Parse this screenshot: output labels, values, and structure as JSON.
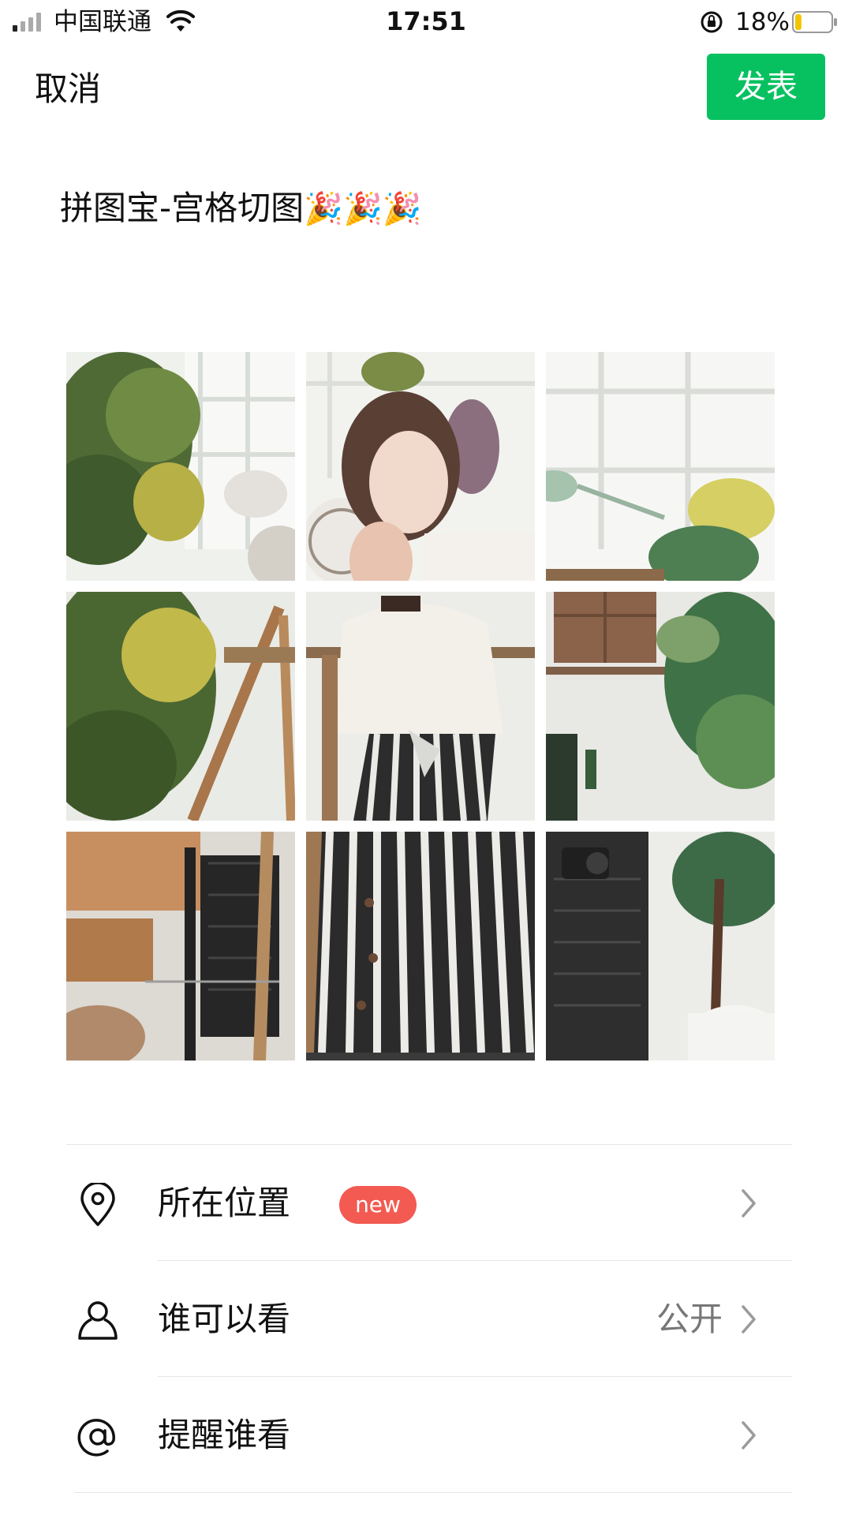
{
  "status_bar": {
    "carrier": "中国联通",
    "time": "17:51",
    "battery_percent": "18%",
    "battery_level": 0.18,
    "icons": [
      "signal-icon",
      "wifi-icon",
      "rotation-lock-icon",
      "battery-icon"
    ]
  },
  "nav": {
    "cancel_label": "取消",
    "publish_label": "发表",
    "publish_color": "#07c160"
  },
  "post": {
    "text": "拼图宝-宫格切图",
    "emoji": "🎉🎉🎉"
  },
  "photo_grid": {
    "rows": 3,
    "cols": 3
  },
  "options": [
    {
      "label": "所在位置",
      "badge": "new",
      "value": "",
      "icon": "location-pin-icon"
    },
    {
      "label": "谁可以看",
      "badge": "",
      "value": "公开",
      "icon": "person-icon"
    },
    {
      "label": "提醒谁看",
      "badge": "",
      "value": "",
      "icon": "at-sign-icon"
    }
  ],
  "colors": {
    "badge": "#f25a52",
    "value_text": "#777777",
    "divider": "#e6e6e6"
  }
}
